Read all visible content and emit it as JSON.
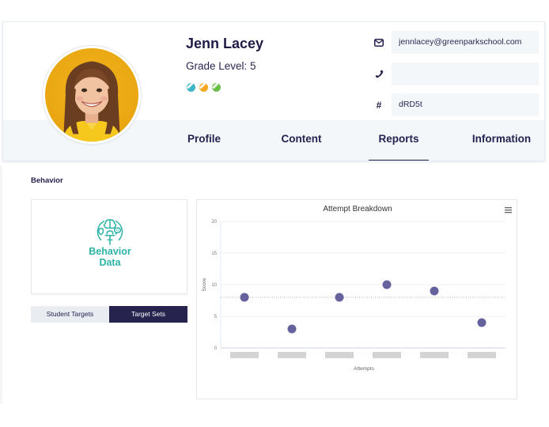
{
  "student": {
    "name": "Jenn Lacey",
    "grade_level": "Grade Level: 5",
    "avatar_icon": "student-photo",
    "badges": [
      {
        "name": "badge-teal",
        "color": "#3fb6c6"
      },
      {
        "name": "badge-orange",
        "color": "#f5a623"
      },
      {
        "name": "badge-green",
        "color": "#6cc04a"
      }
    ]
  },
  "contact": {
    "email": {
      "icon": "envelope-icon",
      "value": "jennlacey@greenparkschool.com"
    },
    "phone": {
      "icon": "phone-icon",
      "value": ""
    },
    "id": {
      "icon": "hash-icon",
      "value": "dRD5t"
    }
  },
  "tabs": [
    {
      "label": "Profile",
      "active": false
    },
    {
      "label": "Content",
      "active": false
    },
    {
      "label": "Reports",
      "active": true
    },
    {
      "label": "Information",
      "active": false
    }
  ],
  "behavior": {
    "section_title": "Behavior",
    "logo_text_line1": "Behavior",
    "logo_text_line2": "Data",
    "segmented": {
      "left_label": "Student Targets",
      "right_label": "Target Sets",
      "selected": "Target Sets"
    }
  },
  "colors": {
    "primary_navy": "#26234f",
    "accent_teal": "#2db3a6",
    "point_color": "#65629e"
  },
  "chart_data": {
    "type": "scatter",
    "title": "Attempt Breakdown",
    "xlabel": "Attempts",
    "ylabel": "Score",
    "x_categories": [
      "",
      "",
      "",
      "",
      "",
      ""
    ],
    "x_categories_redacted": true,
    "values": [
      8,
      3,
      8,
      10,
      9,
      4
    ],
    "reference_line": {
      "value": 8,
      "style": "dotted"
    },
    "ylim": [
      0,
      20
    ],
    "yticks": [
      0,
      5,
      10,
      15,
      20
    ],
    "grid": true,
    "legend": "none",
    "menu_icon": "hamburger-menu-icon"
  }
}
